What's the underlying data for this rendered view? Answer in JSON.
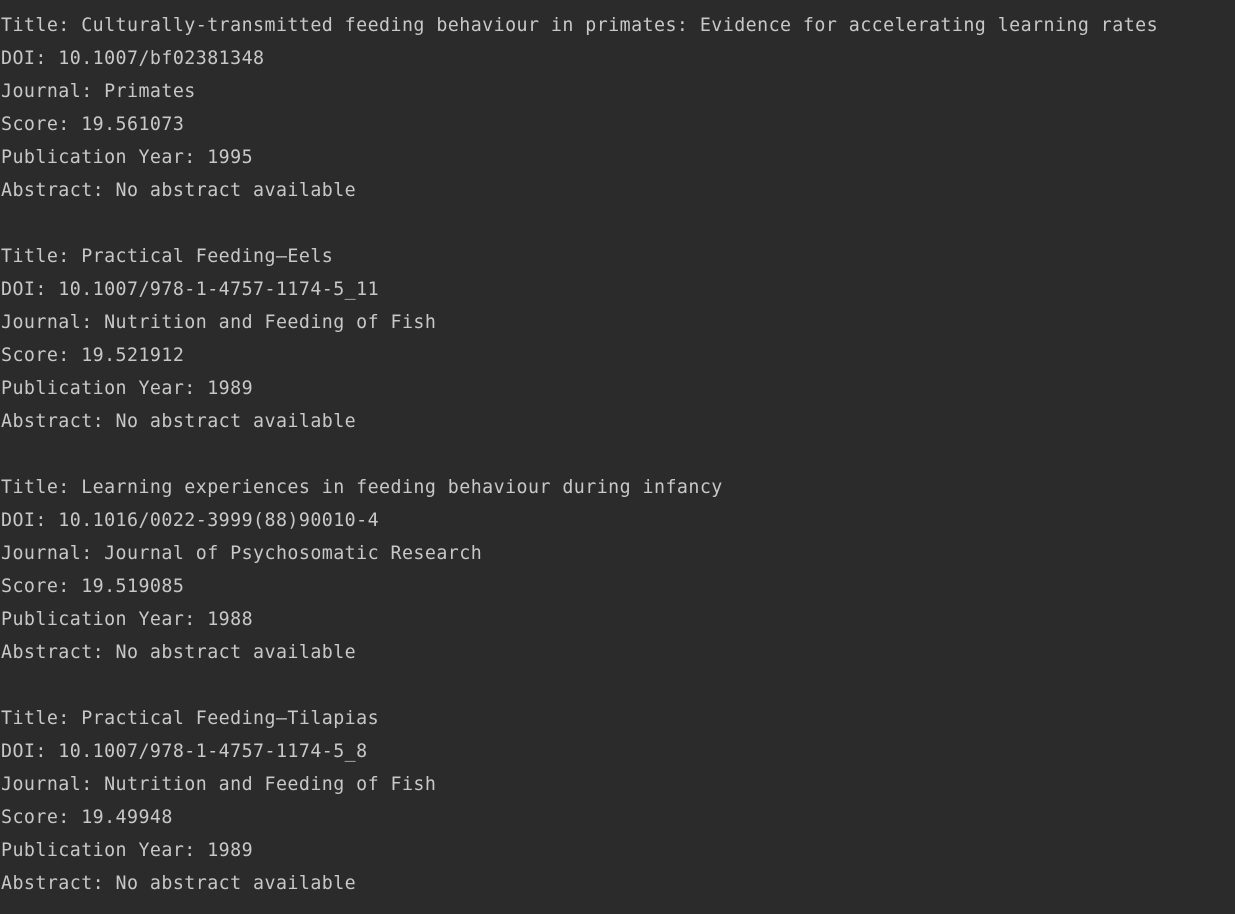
{
  "records": [
    {
      "title": "Title: Culturally-transmitted feeding behaviour in primates: Evidence for accelerating learning rates",
      "doi": "DOI: 10.1007/bf02381348",
      "journal": "Journal: Primates",
      "score": "Score: 19.561073",
      "year": "Publication Year: 1995",
      "abstract": "Abstract: No abstract available"
    },
    {
      "title": "Title: Practical Feeding—Eels",
      "doi": "DOI: 10.1007/978-1-4757-1174-5_11",
      "journal": "Journal: Nutrition and Feeding of Fish",
      "score": "Score: 19.521912",
      "year": "Publication Year: 1989",
      "abstract": "Abstract: No abstract available"
    },
    {
      "title": "Title: Learning experiences in feeding behaviour during infancy",
      "doi": "DOI: 10.1016/0022-3999(88)90010-4",
      "journal": "Journal: Journal of Psychosomatic Research",
      "score": "Score: 19.519085",
      "year": "Publication Year: 1988",
      "abstract": "Abstract: No abstract available"
    },
    {
      "title": "Title: Practical Feeding—Tilapias",
      "doi": "DOI: 10.1007/978-1-4757-1174-5_8",
      "journal": "Journal: Nutrition and Feeding of Fish",
      "score": "Score: 19.49948",
      "year": "Publication Year: 1989",
      "abstract": "Abstract: No abstract available"
    }
  ],
  "colors": {
    "background": "#2b2b2b",
    "text": "#c8c8c8"
  }
}
